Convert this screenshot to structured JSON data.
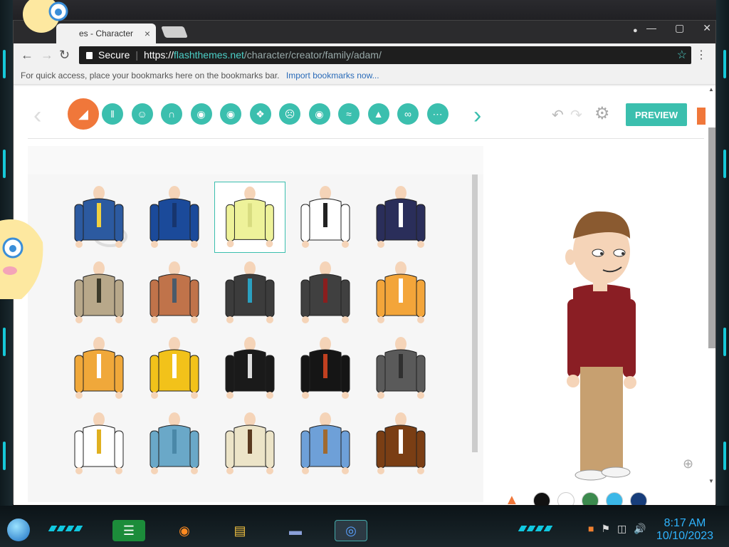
{
  "browser": {
    "tab_title": "es - Character",
    "tab_close": "×",
    "secure_label": "Secure",
    "url_scheme": "https",
    "url_host": "flashthemes.net",
    "url_path": "/character/creator/family/adam/",
    "bookmarks_prompt": "For quick access, place your bookmarks here on the bookmarks bar.",
    "import_link": "Import bookmarks now..."
  },
  "creator": {
    "preview_label": "PREVIEW",
    "categories": [
      {
        "name": "tops",
        "icon": "shirt-icon"
      },
      {
        "name": "bottoms",
        "icon": "pants-icon"
      },
      {
        "name": "face",
        "icon": "face-icon"
      },
      {
        "name": "hair",
        "icon": "hair-icon"
      },
      {
        "name": "beard",
        "icon": "beard-icon"
      },
      {
        "name": "mouth",
        "icon": "lips-icon"
      },
      {
        "name": "accessory",
        "icon": "tag-icon"
      },
      {
        "name": "expression",
        "icon": "frown-icon"
      },
      {
        "name": "eyes",
        "icon": "eye-icon"
      },
      {
        "name": "eyebrows",
        "icon": "eyebrow-icon"
      },
      {
        "name": "nose",
        "icon": "nose-icon"
      },
      {
        "name": "glasses",
        "icon": "glasses-icon"
      },
      {
        "name": "skin",
        "icon": "freckles-icon"
      }
    ],
    "colors": [
      "#111111",
      "#ffffff",
      "#3c8a4e",
      "#3bb8e8",
      "#173d7a"
    ],
    "items": [
      {
        "id": "police-jacket",
        "shirt": "#2c5aa0",
        "accent": "#f0d040",
        "selected": false
      },
      {
        "id": "puffer-jacket",
        "shirt": "#1b4a9a",
        "accent": "#17356e",
        "selected": false
      },
      {
        "id": "yellow-shirt",
        "shirt": "#eef29a",
        "accent": "#d8dc80",
        "selected": true
      },
      {
        "id": "tuxedo-white",
        "shirt": "#ffffff",
        "accent": "#222222",
        "selected": false
      },
      {
        "id": "navy-tuxedo",
        "shirt": "#2a2e5a",
        "accent": "#ffffff",
        "selected": false
      },
      {
        "id": "camo-jacket",
        "shirt": "#b8a88a",
        "accent": "#3c3a2a",
        "selected": false
      },
      {
        "id": "overalls",
        "shirt": "#c0734a",
        "accent": "#4a5a6a",
        "selected": false
      },
      {
        "id": "grey-suit",
        "shirt": "#3c3c3c",
        "accent": "#2aa0c0",
        "selected": false
      },
      {
        "id": "torn-suit",
        "shirt": "#404040",
        "accent": "#8a1e1e",
        "selected": false
      },
      {
        "id": "jersey-8",
        "shirt": "#f3a53a",
        "accent": "#ffffff",
        "selected": false
      },
      {
        "id": "jersey-0",
        "shirt": "#f0a83a",
        "accent": "#ffffff",
        "selected": false
      },
      {
        "id": "jersey-1",
        "shirt": "#f2c21a",
        "accent": "#ffffff",
        "selected": false
      },
      {
        "id": "skull-tee",
        "shirt": "#1a1a1a",
        "accent": "#dddddd",
        "selected": false
      },
      {
        "id": "leather-jacket",
        "shirt": "#151515",
        "accent": "#c04020",
        "selected": false
      },
      {
        "id": "gi-robe",
        "shirt": "#5a5a5a",
        "accent": "#303030",
        "selected": false
      },
      {
        "id": "chain-tee",
        "shirt": "#ffffff",
        "accent": "#e0b020",
        "selected": false
      },
      {
        "id": "blue-sweater",
        "shirt": "#6aa8c8",
        "accent": "#4a88a8",
        "selected": false
      },
      {
        "id": "pirate-vest",
        "shirt": "#ece4c8",
        "accent": "#5a3a20",
        "selected": false
      },
      {
        "id": "brown-vest",
        "shirt": "#6ea0d8",
        "accent": "#a06a30",
        "selected": false
      },
      {
        "id": "brown-coat",
        "shirt": "#7a3e14",
        "accent": "#ffffff",
        "selected": false
      }
    ]
  },
  "taskbar": {
    "time": "8:17 AM",
    "date": "10/10/2023"
  }
}
